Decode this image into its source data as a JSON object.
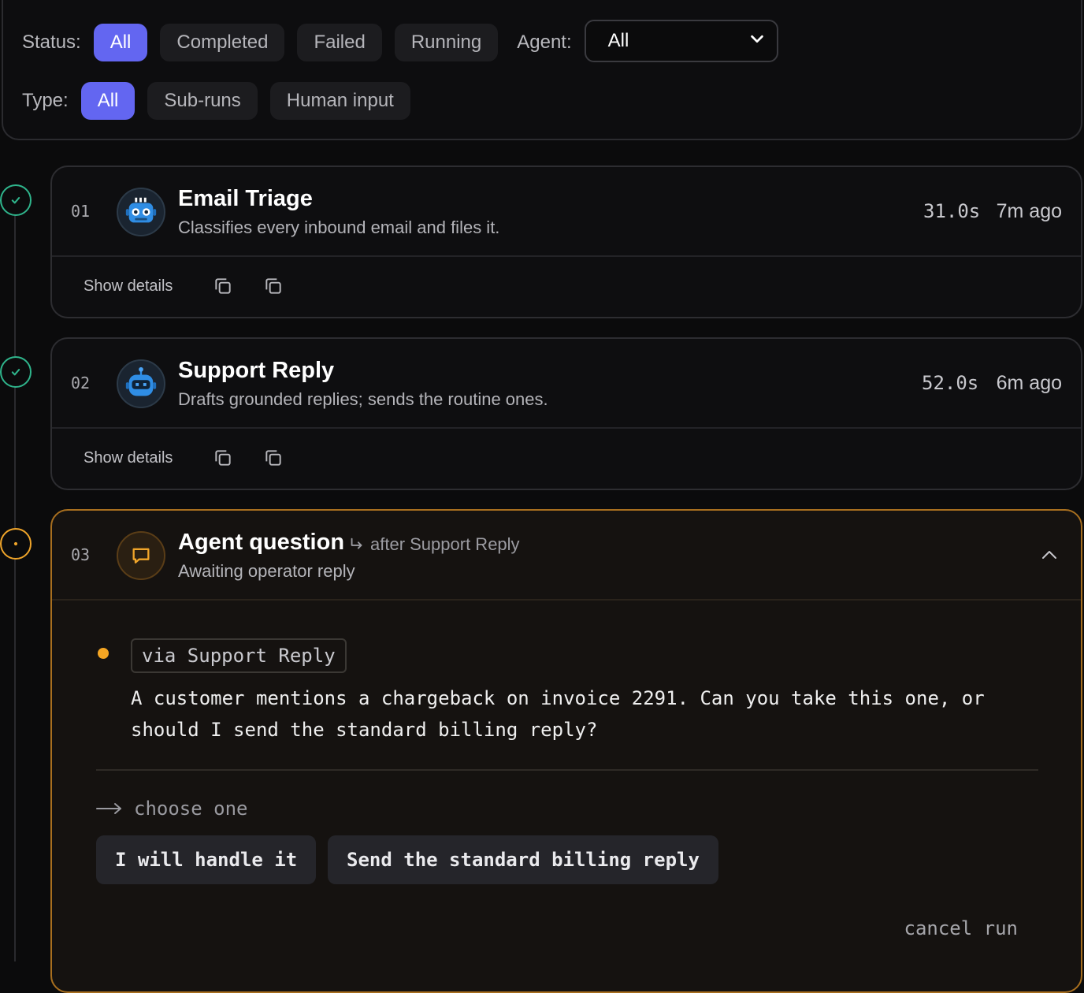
{
  "filters": {
    "status_label": "Status:",
    "status_options": [
      "All",
      "Completed",
      "Failed",
      "Running"
    ],
    "status_selected": "All",
    "agent_label": "Agent:",
    "agent_value": "All",
    "type_label": "Type:",
    "type_options": [
      "All",
      "Sub-runs",
      "Human input"
    ],
    "type_selected": "All"
  },
  "runs": [
    {
      "index": "01",
      "title": "Email Triage",
      "description": "Classifies every inbound email and files it.",
      "duration": "31.0s",
      "ago": "7m ago",
      "status": "completed",
      "show_details": "Show details",
      "avatar_icon": "robot-icon"
    },
    {
      "index": "02",
      "title": "Support Reply",
      "description": "Drafts grounded replies; sends the routine ones.",
      "duration": "52.0s",
      "ago": "6m ago",
      "status": "completed",
      "show_details": "Show details",
      "avatar_icon": "robot-icon"
    }
  ],
  "question": {
    "index": "03",
    "title": "Agent question",
    "after": "after Support Reply",
    "subtitle": "Awaiting operator reply",
    "via": "via Support Reply",
    "text": "A customer mentions a chargeback on invoice 2291. Can you take this one, or should I send the standard billing reply?",
    "choose_label": "choose one",
    "options": [
      "I will handle it",
      "Send the standard billing reply"
    ],
    "cancel_label": "cancel run",
    "status": "awaiting"
  },
  "colors": {
    "accent": "#6366f1",
    "success": "#2fb58c",
    "warning": "#f0a52a"
  }
}
